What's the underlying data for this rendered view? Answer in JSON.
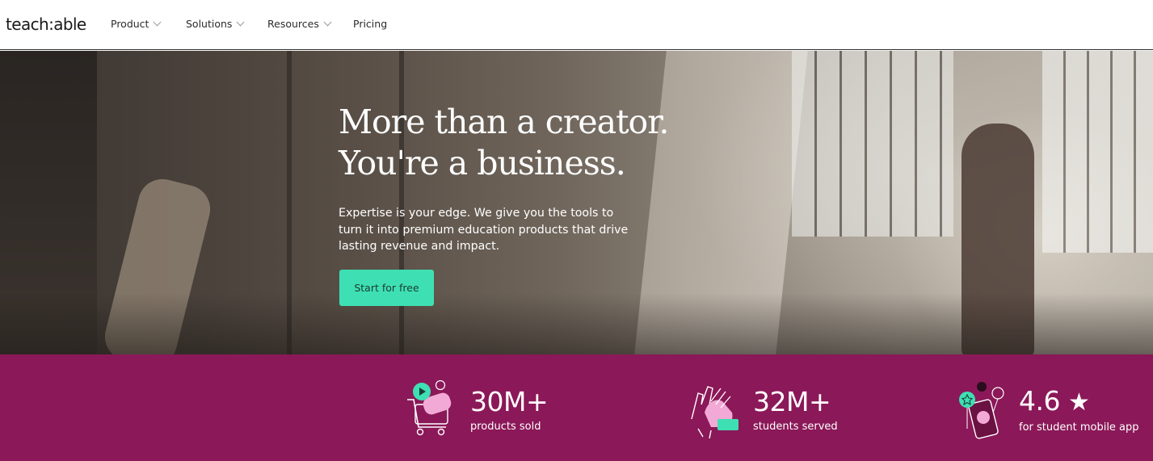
{
  "nav": {
    "logo": "teach:able",
    "items": [
      {
        "label": "Product",
        "has_dropdown": true
      },
      {
        "label": "Solutions",
        "has_dropdown": true
      },
      {
        "label": "Resources",
        "has_dropdown": true
      },
      {
        "label": "Pricing",
        "has_dropdown": false
      }
    ]
  },
  "hero": {
    "title_line1": "More than a creator.",
    "title_line2": "You're a business.",
    "subtitle": "Expertise is your edge. We give you the tools to turn it into premium education products that drive lasting revenue and impact.",
    "cta_label": "Start for free"
  },
  "stats": [
    {
      "value": "30M+",
      "label": "products sold",
      "icon": "shopping-cart-icon"
    },
    {
      "value": "32M+",
      "label": "students served",
      "icon": "raised-hands-icon"
    },
    {
      "value": "4.6",
      "label": "for student mobile app",
      "icon": "mobile-app-rating-icon",
      "suffix_icon": "star-icon"
    }
  ],
  "colors": {
    "accent": "#3ee0b3",
    "stats_bg": "#8b1858",
    "icon_pink": "#f2a9d6",
    "text_light": "#ffffff"
  }
}
